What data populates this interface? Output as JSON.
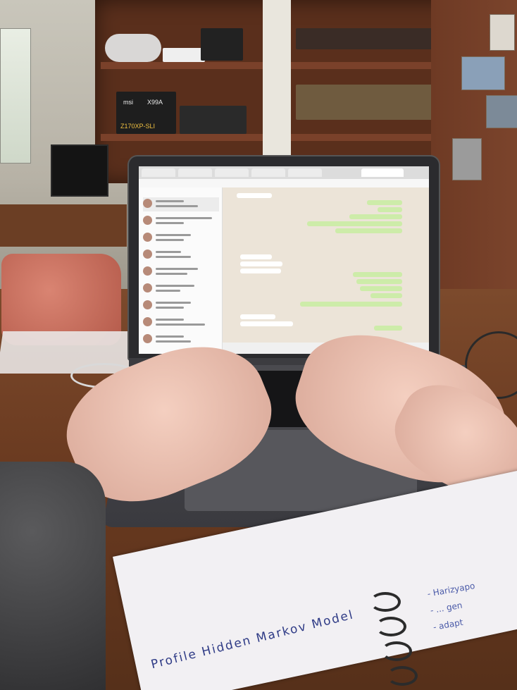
{
  "scene": {
    "description_colors": {
      "desk": "#6a3a20",
      "laptop": "#2b2b2e",
      "chat_outgoing": "#cdeca9",
      "chat_background": "#ece4d8",
      "ink": "#2f3b86"
    }
  },
  "notebook": {
    "handwriting_main": "Profile Hidden Markov Model",
    "handwriting_right": "- Harizyapo\n- ... gen\n- adapt"
  },
  "boxes": {
    "msi_label": "msi",
    "model_label": "X99A",
    "board_label": "Z170XP-SLI"
  }
}
